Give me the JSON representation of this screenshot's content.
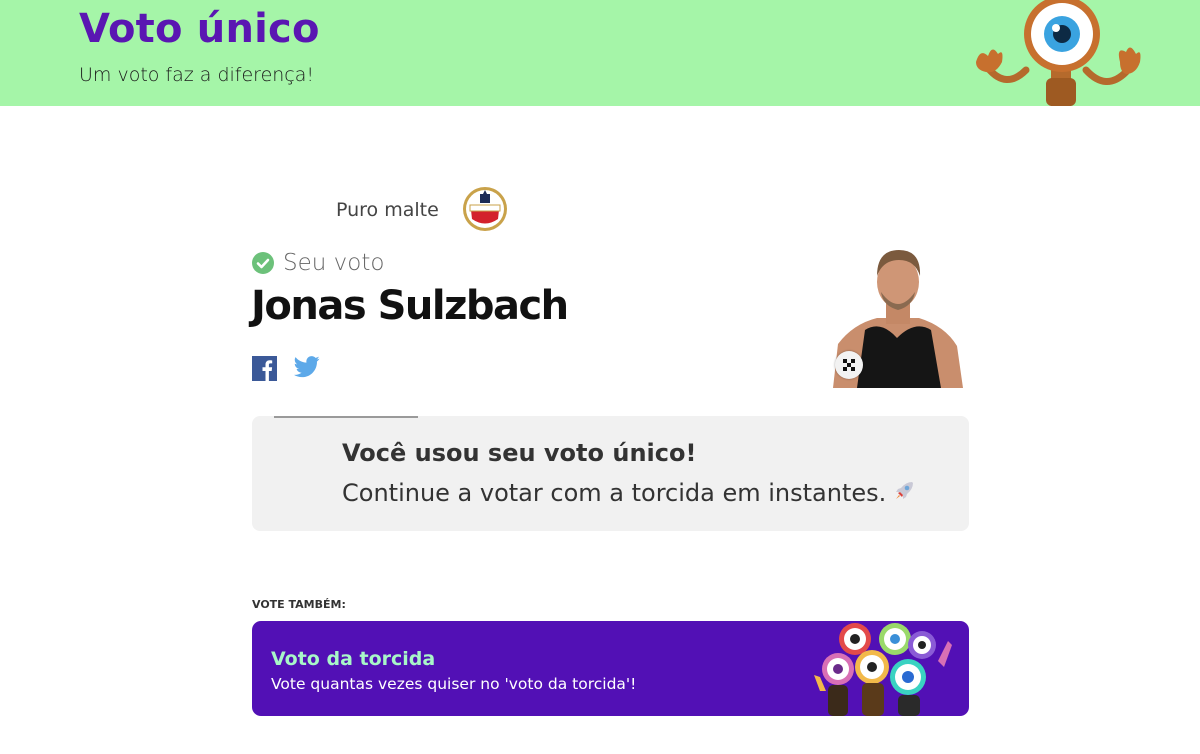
{
  "header": {
    "title": "Voto único",
    "subtitle": "Um voto faz a diferença!",
    "background": "#a5f5a8",
    "title_color": "#5a16b2"
  },
  "sponsor": {
    "text": "Puro malte"
  },
  "vote": {
    "label": "Seu voto",
    "candidate": "Jonas Sulzbach"
  },
  "share": {
    "facebook_icon": "facebook-icon",
    "twitter_icon": "twitter-icon"
  },
  "info": {
    "title": "Você usou seu voto único!",
    "text": "Continue a votar com a torcida em instantes."
  },
  "also": {
    "heading": "VOTE TAMBÉM:",
    "card_title": "Voto da torcida",
    "card_subtitle": "Vote quantas vezes quiser no 'voto da torcida'!",
    "card_color": "#5210b5",
    "card_title_color": "#a8f6c8"
  }
}
